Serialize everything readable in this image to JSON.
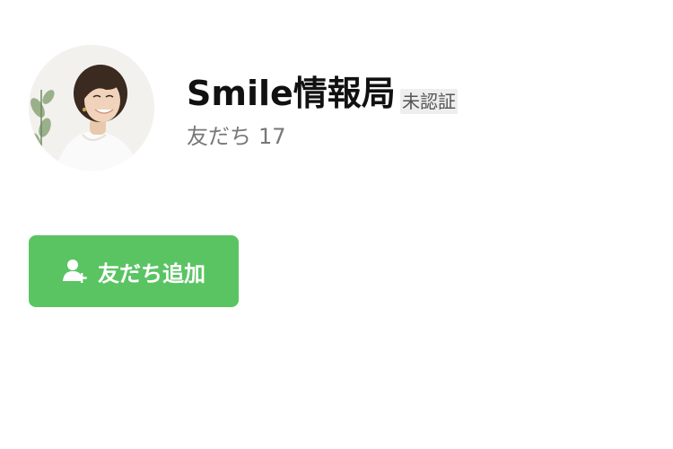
{
  "profile": {
    "name": "Smile情報局",
    "verification_badge": "未認証",
    "friends_label": "友だち",
    "friends_count": "17"
  },
  "actions": {
    "add_friend_label": "友だち追加",
    "add_friend_icon": "person-add-icon"
  },
  "colors": {
    "accent_green": "#5ac463",
    "badge_bg": "#eeeeee",
    "muted_text": "#777777"
  }
}
